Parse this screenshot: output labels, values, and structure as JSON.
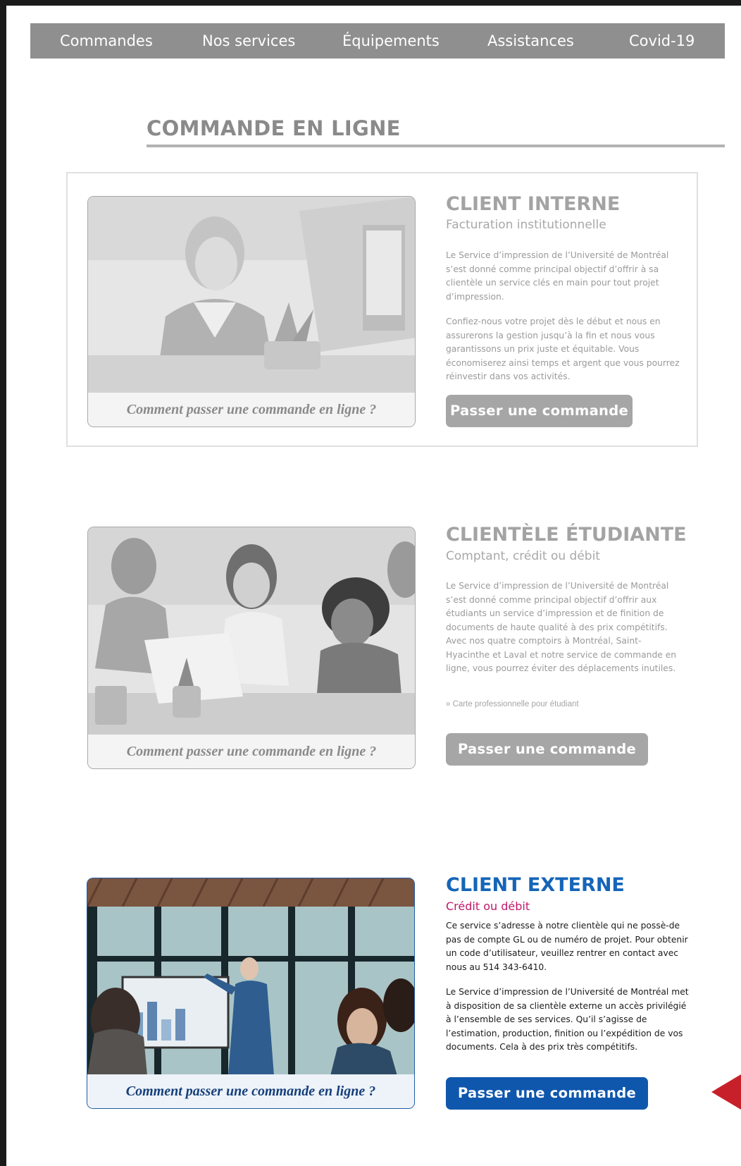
{
  "nav": {
    "items": [
      "Commandes",
      "Nos services",
      "Équipements",
      "Assistances",
      "Covid-19"
    ]
  },
  "page_title": "COMMANDE EN LIGNE",
  "sections": [
    {
      "title": "CLIENT INTERNE",
      "subtitle": "Facturation institutionnelle",
      "paragraphs": [
        "Le Service d’impression de l’Université de Montréal s’est donné comme principal objectif d’offrir à sa clientèle un service clés en main pour tout projet d’impression.",
        "Confiez-nous votre projet dès le début et nous en assurerons la gestion jusqu’à la fin et nous vous garantissons un prix juste et équitable. Vous économiserez ainsi temps et argent que vous pourrez réinvestir dans vos activités."
      ],
      "caption": "Comment passer une commande en ligne ?",
      "cta": "Passer une commande"
    },
    {
      "title": "CLIENTÈLE ÉTUDIANTE",
      "subtitle": "Comptant, crédit ou débit",
      "paragraphs": [
        "Le Service d’impression de l’Université de Montréal s’est donné comme principal objectif d’offrir aux étudiants un service d’impression et de finition de documents de haute qualité à des prix compétitifs. Avec nos quatre comptoirs à Montréal, Saint-Hyacinthe et Laval et notre service de commande en ligne, vous pourrez éviter des déplacements inutiles."
      ],
      "link": "»  Carte professionnelle pour étudiant",
      "caption": "Comment passer une commande en ligne ?",
      "cta": "Passer une commande"
    },
    {
      "title": "CLIENT EXTERNE",
      "subtitle": "Crédit ou débit",
      "paragraphs": [
        "Ce service s’adresse à notre clientèle qui ne possè-de pas de compte GL ou de numéro de projet. Pour obtenir un code d’utilisateur, veuillez rentrer en contact avec nous au 514 343-6410.",
        "Le Service d’impression de l’Université de Montréal met à disposition de sa clientèle externe un accès privilégié à l’ensemble de ses services. Qu’il s’agisse de l’estimation, production, finition ou l’expédition de vos documents. Cela à des prix très compétitifs."
      ],
      "caption": "Comment passer une commande en ligne ?",
      "cta": "Passer une commande"
    }
  ],
  "colors": {
    "nav_bg": "#8f8f8f",
    "muted_text": "#9a9a9a",
    "accent_blue": "#1565b8",
    "accent_magenta": "#c2186b",
    "indicator_red": "#c8202a"
  }
}
